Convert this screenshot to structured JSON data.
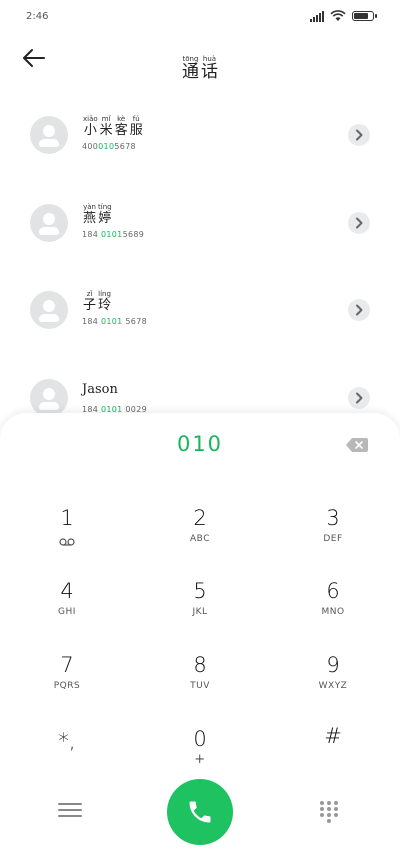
{
  "status_bar": {
    "time": "2:46",
    "battery_level": 0.85
  },
  "header": {
    "title": [
      {
        "pinyin": "tōng",
        "char": "通"
      },
      {
        "pinyin": "huà",
        "char": "话"
      }
    ]
  },
  "contacts": [
    {
      "name_ruby": [
        {
          "pinyin": "xiǎo",
          "char": "小"
        },
        {
          "pinyin": "mǐ",
          "char": "米"
        },
        {
          "pinyin": "kè",
          "char": "客"
        },
        {
          "pinyin": "fú",
          "char": "服"
        }
      ],
      "number_pre": "400",
      "number_hl": "010",
      "number_post": "5678"
    },
    {
      "name_ruby": [
        {
          "pinyin": "yàn",
          "char": "燕"
        },
        {
          "pinyin": "tíng",
          "char": "婷"
        }
      ],
      "number_pre": "184 ",
      "number_hl": "0101",
      "number_post": "5689"
    },
    {
      "name_ruby": [
        {
          "pinyin": "zǐ",
          "char": "子"
        },
        {
          "pinyin": "líng",
          "char": "玲"
        }
      ],
      "number_pre": "184 ",
      "number_hl": "0101",
      "number_post": " 5678"
    },
    {
      "name": "Jason",
      "number_pre": "184 ",
      "number_hl": "0101",
      "number_post": " 0029"
    }
  ],
  "dialpad": {
    "input": "010",
    "keys": [
      {
        "digit": "1",
        "letters": "",
        "icon": "voicemail-icon"
      },
      {
        "digit": "2",
        "letters": "ABC"
      },
      {
        "digit": "3",
        "letters": "DEF"
      },
      {
        "digit": "4",
        "letters": "GHI"
      },
      {
        "digit": "5",
        "letters": "JKL"
      },
      {
        "digit": "6",
        "letters": "MNO"
      },
      {
        "digit": "7",
        "letters": "PQRS"
      },
      {
        "digit": "8",
        "letters": "TUV"
      },
      {
        "digit": "9",
        "letters": "WXYZ"
      },
      {
        "digit": "*,",
        "letters": ""
      },
      {
        "digit": "0",
        "letters": "+"
      },
      {
        "digit": "#",
        "letters": ""
      }
    ]
  },
  "colors": {
    "accent": "#1bb55c",
    "call_button": "#1ec260"
  },
  "icons": {
    "back": "arrow-left-icon",
    "detail": "chevron-right-icon",
    "backspace": "backspace-icon",
    "menu": "menu-icon",
    "call": "phone-icon",
    "keypad": "keypad-icon"
  }
}
